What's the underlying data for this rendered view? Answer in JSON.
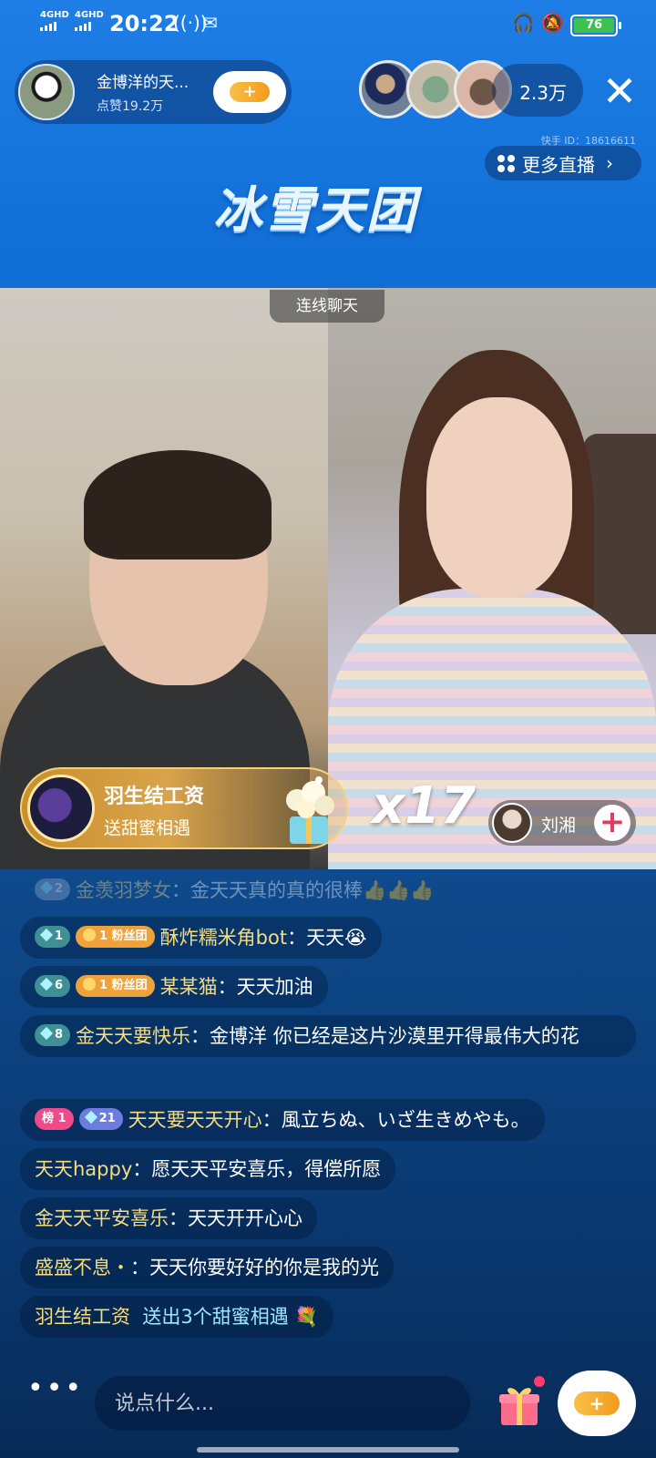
{
  "status_bar": {
    "network_1": "4GHD",
    "network_2": "4GHD",
    "time": "20:22",
    "battery": "76"
  },
  "host": {
    "name": "金博洋的天...",
    "likes": "点赞19.2万"
  },
  "viewers": {
    "count": "2.3万"
  },
  "kuaishou_id": "快手 ID：18616611",
  "more_live_label": "更多直播",
  "banner_title": "冰雪天团",
  "video": {
    "link_chat_label": "连线聊天",
    "gift": {
      "sender": "羽生结工资",
      "description": "送甜蜜相遇",
      "count": "x17"
    },
    "guest_name": "刘湘"
  },
  "chat": {
    "messages": [
      {
        "level": "2",
        "user": "金羡羽梦女",
        "text": "金天天真的真的很棒👍👍👍"
      },
      {
        "level": "1",
        "fan_badge": "粉丝团",
        "fan_level": "1",
        "user": "酥炸糯米角bot",
        "text": "天天😭"
      },
      {
        "level": "6",
        "fan_badge": "粉丝团",
        "fan_level": "1",
        "user": "某某猫",
        "text": "天天加油"
      },
      {
        "level": "8",
        "user": "金天天要快乐",
        "text": "金博洋 你已经是这片沙漠里开得最伟大的花"
      },
      {
        "rank_badge": "榜 1",
        "level": "21",
        "user": "天天要天天开心",
        "text": "風立ちぬ、いざ生きめやも。"
      },
      {
        "user": "天天happy",
        "text": "愿天天平安喜乐，得偿所愿"
      },
      {
        "user": "金天天平安喜乐",
        "text": "天天开开心心"
      },
      {
        "user": "盛盛不息・",
        "text": "天天你要好好的你是我的光"
      },
      {
        "user": "羽生结工资",
        "text": "送出3个甜蜜相遇"
      }
    ]
  },
  "input": {
    "placeholder": "说点什么..."
  },
  "colors": {
    "top_blue": "#1474db",
    "chat_bg": "#0a3a73",
    "accent_gold": "#f6dc7e",
    "accent_red": "#e53a5f"
  }
}
